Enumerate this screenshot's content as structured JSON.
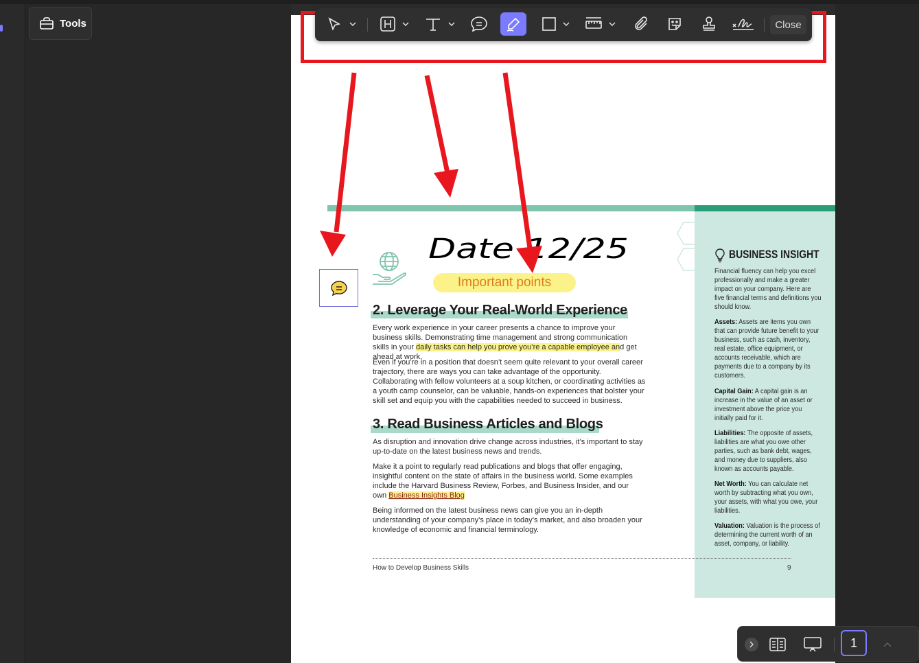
{
  "sidebar": {
    "tools_label": "Tools"
  },
  "toolbar": {
    "tools": [
      "select",
      "highlight-text",
      "text",
      "comment",
      "pen",
      "shape",
      "measure",
      "attach",
      "sticker",
      "stamp",
      "signature"
    ],
    "close_label": "Close",
    "active_tool": "pen"
  },
  "annotations": {
    "handwriting": "Date 12/25",
    "highlight_label": "Important points",
    "outline_color": "#e8171e"
  },
  "document": {
    "section2_title": "2. Leverage Your Real-World Experience",
    "section2_p1a": "Every work experience in your career presents a chance to improve your business skills. Demonstrating time management and strong communication skills in your ",
    "section2_p1_hl": "daily tasks can help you prove you’re a capable employee an",
    "section2_p1b": "d get ahead at work.",
    "section2_p2": "Even if you’re in a position that doesn’t seem quite relevant to your overall career trajectory, there are ways you can take advantage of the opportunity. Collaborating with fellow volunteers at a soup kitchen, or coordinating activities as a youth camp counselor, can be valuable, hands-on experiences that bolster your skill set and equip you with the capabilities needed to succeed in business.",
    "section3_title": "3. Read Business Articles and Blogs",
    "section3_p1": "As disruption and innovation drive change across industries, it’s important to stay up-to-date on the latest business news and trends.",
    "section3_p2a": "Make it a point to regularly read publications and blogs that offer engaging, insightful content on the state of affairs in the business world. Some examples include the Harvard Business Review, Forbes, and Business Insider, and our own ",
    "section3_p2_link": "Business Insights Blog",
    "section3_p3": "Being informed on the latest business news can give you an in-depth understanding of your company’s place in today’s market, and also broaden your knowledge of economic and financial terminology.",
    "footer_title": "How to Develop Business Skills",
    "page_number_printed": "9"
  },
  "insight": {
    "title": "BUSINESS INSIGHT",
    "intro": "Financial fluency can help you excel professionally and make a greater impact on your company. Here are five financial terms and definitions you should know.",
    "terms": [
      {
        "term": "Assets:",
        "def": " Assets are items you own that can provide future benefit to your business, such as cash, inventory, real estate, office equipment, or accounts receivable, which are payments due to a company by its customers."
      },
      {
        "term": "Capital Gain:",
        "def": " A capital gain is an increase in the value of an asset or investment above the price you initially paid for it."
      },
      {
        "term": "Liabilities:",
        "def": " The opposite of assets, liabilities are what you owe other parties, such as bank debt, wages, and money due to suppliers, also known as accounts payable."
      },
      {
        "term": "Net Worth:",
        "def": " You can calculate net worth by subtracting what you own, your assets, with what you owe, your liabilities."
      },
      {
        "term": "Valuation:",
        "def": " Valuation is the process of determining the current worth of an asset, company, or liability."
      }
    ]
  },
  "bottombar": {
    "current_page": "1"
  }
}
